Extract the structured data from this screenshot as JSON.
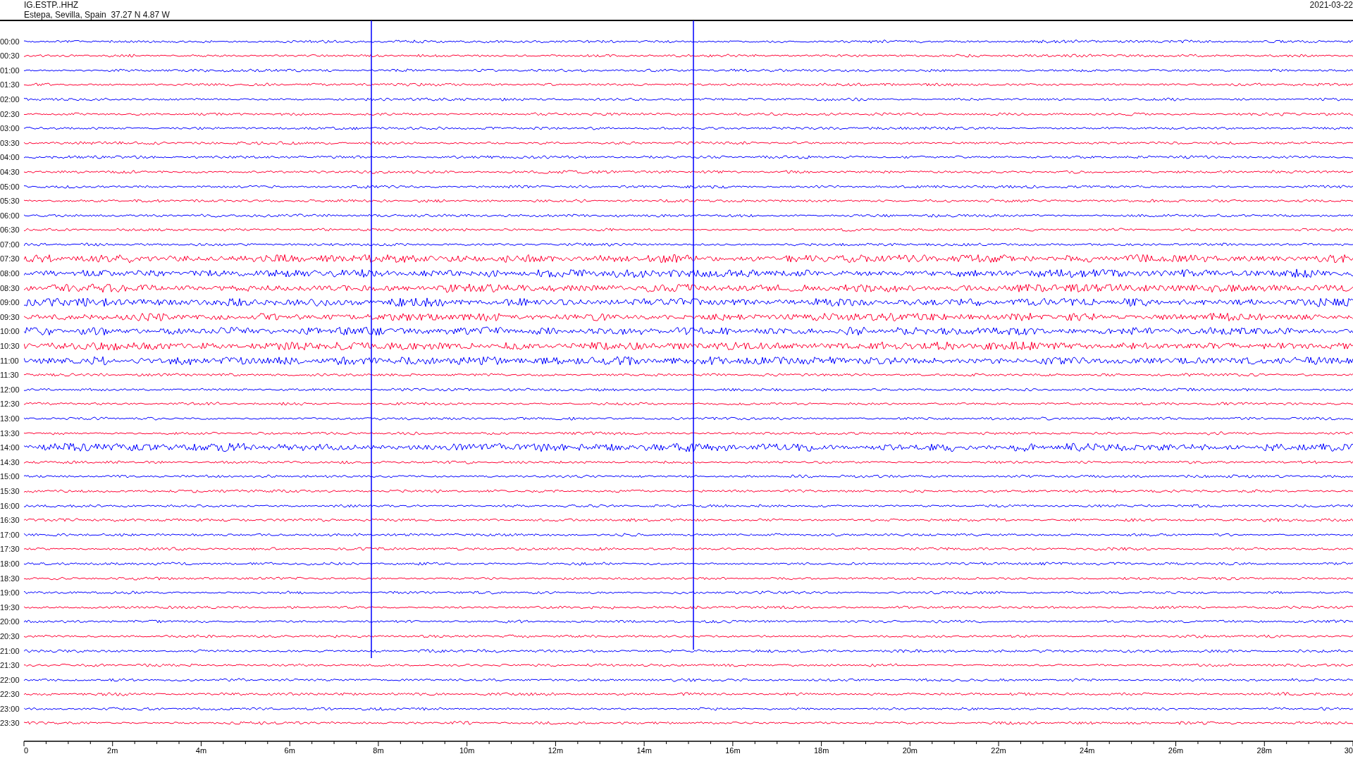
{
  "header": {
    "station": "IG.ESTP..HHZ",
    "location": "Estepa, Sevilla, Spain  37.27 N 4.87 W",
    "date": "2021-03-22"
  },
  "rows": [
    {
      "time": "00:00",
      "color": "#0000ff",
      "kind": "quiet"
    },
    {
      "time": "00:30",
      "color": "#ff0033",
      "kind": "quiet"
    },
    {
      "time": "01:00",
      "color": "#0000ff",
      "kind": "quiet"
    },
    {
      "time": "01:30",
      "color": "#ff0033",
      "kind": "quiet"
    },
    {
      "time": "02:00",
      "color": "#0000ff",
      "kind": "quiet"
    },
    {
      "time": "02:30",
      "color": "#ff0033",
      "kind": "quiet"
    },
    {
      "time": "03:00",
      "color": "#0000ff",
      "kind": "quiet"
    },
    {
      "time": "03:30",
      "color": "#ff0033",
      "kind": "quiet"
    },
    {
      "time": "04:00",
      "color": "#0000ff",
      "kind": "quiet"
    },
    {
      "time": "04:30",
      "color": "#ff0033",
      "kind": "quiet"
    },
    {
      "time": "05:00",
      "color": "#0000ff",
      "kind": "quiet"
    },
    {
      "time": "05:30",
      "color": "#ff0033",
      "kind": "quiet"
    },
    {
      "time": "06:00",
      "color": "#0000ff",
      "kind": "quiet"
    },
    {
      "time": "06:30",
      "color": "#ff0033",
      "kind": "quiet"
    },
    {
      "time": "07:00",
      "color": "#0000ff",
      "kind": "quiet"
    },
    {
      "time": "07:30",
      "color": "#ff0033",
      "kind": "noisy"
    },
    {
      "time": "08:00",
      "color": "#0000ff",
      "kind": "noisy"
    },
    {
      "time": "08:30",
      "color": "#ff0033",
      "kind": "noisy"
    },
    {
      "time": "09:00",
      "color": "#0000ff",
      "kind": "noisy"
    },
    {
      "time": "09:30",
      "color": "#ff0033",
      "kind": "noisy"
    },
    {
      "time": "10:00",
      "color": "#0000ff",
      "kind": "noisy"
    },
    {
      "time": "10:30",
      "color": "#ff0033",
      "kind": "noisy"
    },
    {
      "time": "11:00",
      "color": "#0000ff",
      "kind": "noisy"
    },
    {
      "time": "11:30",
      "color": "#ff0033",
      "kind": "quiet"
    },
    {
      "time": "12:00",
      "color": "#0000ff",
      "kind": "quiet"
    },
    {
      "time": "12:30",
      "color": "#ff0033",
      "kind": "quiet"
    },
    {
      "time": "13:00",
      "color": "#0000ff",
      "kind": "quiet"
    },
    {
      "time": "13:30",
      "color": "#ff0033",
      "kind": "quiet"
    },
    {
      "time": "14:00",
      "color": "#0000ff",
      "kind": "noisy"
    },
    {
      "time": "14:30",
      "color": "#ff0033",
      "kind": "quiet"
    },
    {
      "time": "15:00",
      "color": "#0000ff",
      "kind": "quiet"
    },
    {
      "time": "15:30",
      "color": "#ff0033",
      "kind": "quiet"
    },
    {
      "time": "16:00",
      "color": "#0000ff",
      "kind": "quiet"
    },
    {
      "time": "16:30",
      "color": "#ff0033",
      "kind": "quiet"
    },
    {
      "time": "17:00",
      "color": "#0000ff",
      "kind": "quiet"
    },
    {
      "time": "17:30",
      "color": "#ff0033",
      "kind": "quiet"
    },
    {
      "time": "18:00",
      "color": "#0000ff",
      "kind": "quiet"
    },
    {
      "time": "18:30",
      "color": "#ff0033",
      "kind": "quiet"
    },
    {
      "time": "19:00",
      "color": "#0000ff",
      "kind": "quiet"
    },
    {
      "time": "19:30",
      "color": "#ff0033",
      "kind": "quiet"
    },
    {
      "time": "20:00",
      "color": "#0000ff",
      "kind": "quiet"
    },
    {
      "time": "20:30",
      "color": "#ff0033",
      "kind": "quiet"
    },
    {
      "time": "21:00",
      "color": "#0000ff",
      "kind": "quiet"
    },
    {
      "time": "21:30",
      "color": "#ff0033",
      "kind": "quiet"
    },
    {
      "time": "22:00",
      "color": "#0000ff",
      "kind": "quiet"
    },
    {
      "time": "22:30",
      "color": "#ff0033",
      "kind": "quiet"
    },
    {
      "time": "23:00",
      "color": "#0000ff",
      "kind": "quiet"
    },
    {
      "time": "23:30",
      "color": "#ff0033",
      "kind": "quiet"
    }
  ],
  "axis": {
    "ticks": [
      "0",
      "2m",
      "4m",
      "6m",
      "8m",
      "10m",
      "12m",
      "14m",
      "16m",
      "18m",
      "20m",
      "22m",
      "24m",
      "26m",
      "28m",
      "30"
    ]
  }
}
